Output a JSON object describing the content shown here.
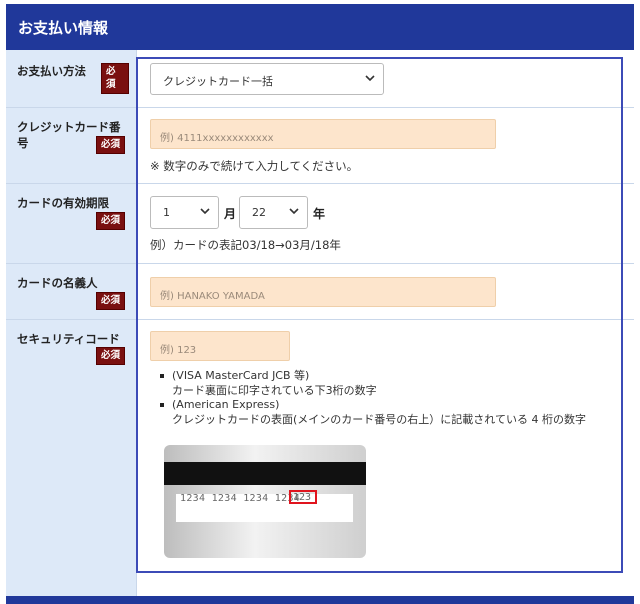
{
  "header": {
    "title": "お支払い情報"
  },
  "required_badge": "必須",
  "fields": {
    "payment_method": {
      "label": "お支払い方法",
      "selected": "クレジットカード一括"
    },
    "card_number": {
      "label": "クレジットカード番号",
      "placeholder": "例) 4111xxxxxxxxxxxx",
      "note": "※ 数字のみで続けて入力してください。"
    },
    "expiry": {
      "label": "カードの有効期限",
      "month_selected": "1",
      "month_unit": "月",
      "year_selected": "22",
      "year_unit": "年",
      "note": "例）カードの表記03/18→03月/18年"
    },
    "holder_name": {
      "label": "カードの名義人",
      "placeholder": "例) HANAKO YAMADA"
    },
    "security_code": {
      "label": "セキュリティコード",
      "placeholder": "例) 123",
      "bullets": [
        {
          "title": "(VISA MasterCard JCB 等)",
          "desc": "カード裏面に印字されている下3桁の数字"
        },
        {
          "title": "(American Express)",
          "desc": "クレジットカードの表面(メインのカード番号の右上）に記載されている 4 桁の数字"
        }
      ],
      "card_image": {
        "number_text": "1234  1234  1234  1234",
        "cvv_text": "123"
      }
    }
  },
  "colors": {
    "header_bg": "#20389a",
    "label_bg": "#dde9f8",
    "input_bg": "#fde5cc",
    "required_bg": "#7a1010",
    "focus_border": "#3c4bb7"
  }
}
